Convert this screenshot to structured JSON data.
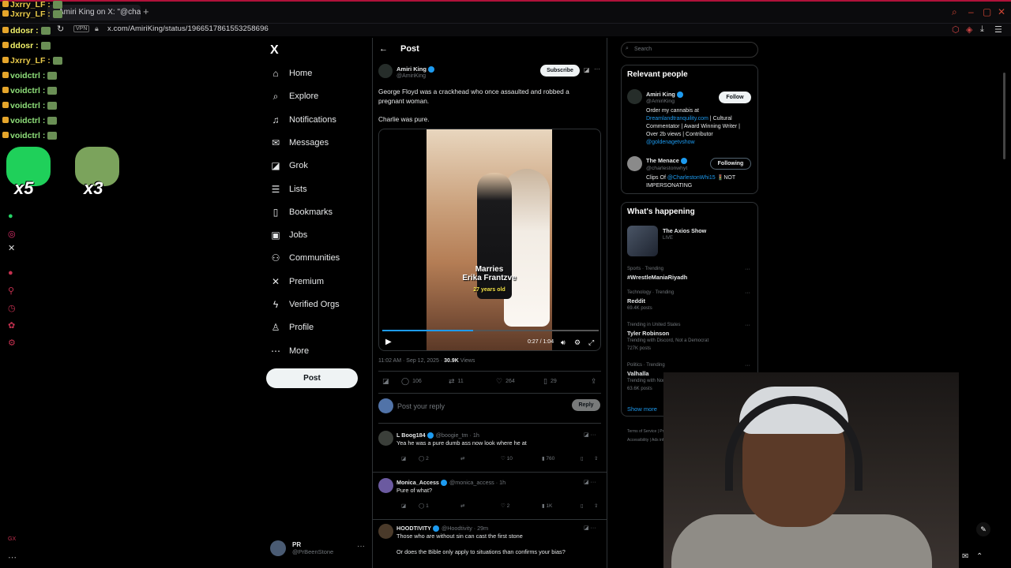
{
  "browser": {
    "tab_title": "Amiri King on X: \"@charlie",
    "url": "x.com/AmiriKing/status/1966517861553258696",
    "vpn_label": "VPN",
    "new_tab": "+"
  },
  "chat": [
    {
      "user": "Jxrry_LF :",
      "color": "#e8c94a"
    },
    {
      "user": "Jxrry_LF :",
      "color": "#e8c94a"
    },
    {
      "user": "ddosr :",
      "color": "#f2f26a"
    },
    {
      "user": "ddosr :",
      "color": "#f2f26a"
    },
    {
      "user": "Jxrry_LF :",
      "color": "#e8c94a"
    },
    {
      "user": "voidctrl :",
      "color": "#8fe07a"
    },
    {
      "user": "voidctrl :",
      "color": "#8fe07a"
    },
    {
      "user": "voidctrl :",
      "color": "#8fe07a"
    },
    {
      "user": "voidctrl :",
      "color": "#8fe07a"
    },
    {
      "user": "voidctrl :",
      "color": "#8fe07a"
    }
  ],
  "emote_multipliers": [
    "x5",
    "x3"
  ],
  "nav": {
    "logo": "X",
    "items": [
      {
        "label": "Home",
        "icon": "home-icon",
        "glyph": "⌂"
      },
      {
        "label": "Explore",
        "icon": "search-icon",
        "glyph": "⌕"
      },
      {
        "label": "Notifications",
        "icon": "bell-icon",
        "glyph": "♫"
      },
      {
        "label": "Messages",
        "icon": "mail-icon",
        "glyph": "✉"
      },
      {
        "label": "Grok",
        "icon": "grok-icon",
        "glyph": "◪"
      },
      {
        "label": "Lists",
        "icon": "list-icon",
        "glyph": "☰"
      },
      {
        "label": "Bookmarks",
        "icon": "bookmark-icon",
        "glyph": "▯"
      },
      {
        "label": "Jobs",
        "icon": "briefcase-icon",
        "glyph": "▣"
      },
      {
        "label": "Communities",
        "icon": "people-icon",
        "glyph": "⚇"
      },
      {
        "label": "Premium",
        "icon": "x-premium-icon",
        "glyph": "✕"
      },
      {
        "label": "Verified Orgs",
        "icon": "lightning-icon",
        "glyph": "ϟ"
      },
      {
        "label": "Profile",
        "icon": "person-icon",
        "glyph": "♙"
      },
      {
        "label": "More",
        "icon": "more-circle-icon",
        "glyph": "⋯"
      }
    ],
    "post_button": "Post",
    "account": {
      "name": "PR",
      "handle": "@PrBeenStone",
      "more": "···"
    }
  },
  "post": {
    "header": "Post",
    "author": {
      "name": "Amiri King",
      "handle": "@AmiriKing"
    },
    "subscribe": "Subscribe",
    "text1": "George Floyd was a crackhead who once assaulted and robbed a pregnant woman.",
    "text2": "Charlie was pure.",
    "video": {
      "caption_line1": "Marries",
      "caption_line2": "Erika Frantzve",
      "caption_line3": "27 years old",
      "time": "0:27 / 1:04",
      "progress": 0.42
    },
    "timestamp": "11:02 AM · Sep 12, 2025 · ",
    "views_count": "30.9K",
    "views_label": " Views",
    "stats": {
      "replies": "106",
      "reposts": "11",
      "likes": "264",
      "bookmarks": "29"
    }
  },
  "reply_box": {
    "placeholder": "Post your reply",
    "button": "Reply"
  },
  "comments": [
    {
      "name": "L Boog184",
      "handle": "@boogie_tm · 1h",
      "text": "Yea he was a pure dumb ass now look where he at",
      "replies": "2",
      "reposts": "",
      "likes": "10",
      "views": "760",
      "avatar": "#3b3f3a"
    },
    {
      "name": "Monica_Access",
      "handle": "@monica_access · 1h",
      "text": "Pure of what?",
      "replies": "1",
      "reposts": "",
      "likes": "2",
      "views": "1K",
      "avatar": "#6b5aa0"
    },
    {
      "name": "HOODTIVITY",
      "handle": "@Hoodtivity · 29m",
      "text": "Those who are without sin can cast the first stone",
      "text2": "Or does the Bible only apply to situations than confirms your bias?",
      "avatar": "#4a3a2a"
    }
  ],
  "search": {
    "placeholder": "Search"
  },
  "relevant": {
    "title": "Relevant people",
    "people": [
      {
        "name": "Amiri King",
        "handle": "@AmiriKing",
        "button": "Follow",
        "bio_pre": "Order my cannabis at ",
        "bio_link": "Dreamlandtranquility.com",
        "bio_post": " | Cultural Commentator | Award Winning Writer | Over 2b views | Contributor ",
        "bio_link2": "@goldenagetvshow"
      },
      {
        "name": "The Menace",
        "handle": "@charlestonwhyt",
        "button": "Following",
        "bio_pre": "Clips Of ",
        "bio_link": "@CharlestonWhi15",
        "bio_post": " 🚦NOT IMPERSONATING"
      }
    ]
  },
  "happening": {
    "title": "What's happening",
    "live": {
      "name": "The Axios Show",
      "tag": "LIVE"
    },
    "trends": [
      {
        "category": "Sports · Trending",
        "name": "#WrestleManiaRiyadh",
        "sub": ""
      },
      {
        "category": "Technology · Trending",
        "name": "Reddit",
        "sub": "69.4K posts"
      },
      {
        "category": "Trending in United States",
        "name": "Tyler Robinson",
        "sub": "Trending with Discord, Not a Democrat",
        "sub2": "727K posts"
      },
      {
        "category": "Politics · Trending",
        "name": "Valhalla",
        "sub": "Trending with Norse, Kash",
        "sub2": "63.6K posts"
      }
    ],
    "show_more": "Show more"
  },
  "footer": {
    "line1": "Terms of Service  |  Privacy Policy  |  Cookie Policy  |",
    "line2": "Accessibility  |  Ads info  |  More ···  © 2025 X Corp."
  }
}
